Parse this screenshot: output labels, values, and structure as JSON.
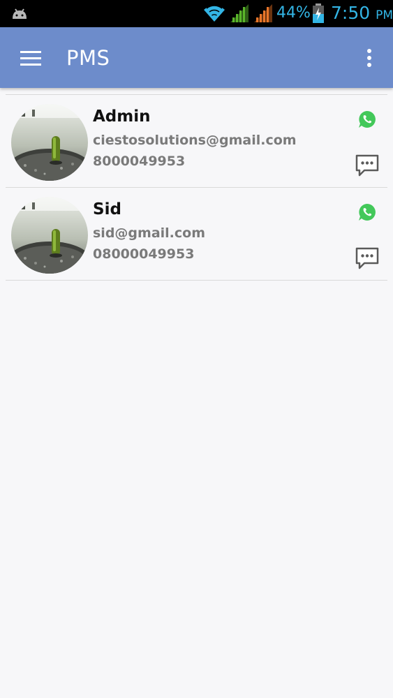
{
  "status_bar": {
    "battery_percent": "44%",
    "time": "7:50",
    "ampm": "PM",
    "icons": [
      "android-icon",
      "wifi-icon",
      "signal-icon",
      "signal-icon",
      "battery-charging-icon"
    ],
    "colors": {
      "text": "#33b5e5",
      "signal1": "#5ab52a",
      "signal2": "#e8762a"
    }
  },
  "app_bar": {
    "title": "PMS",
    "color": "#6d8ccb",
    "menu_icon": "hamburger-menu-icon",
    "overflow_icon": "more-vert-icon"
  },
  "contacts": [
    {
      "name": "Admin",
      "email": "ciestosolutions@gmail.com",
      "phone": "8000049953",
      "avatar": "sprout-photo",
      "actions": [
        "whatsapp-icon",
        "chat-message-icon"
      ]
    },
    {
      "name": "Sid",
      "email": "sid@gmail.com",
      "phone": "08000049953",
      "avatar": "sprout-photo",
      "actions": [
        "whatsapp-icon",
        "chat-message-icon"
      ]
    }
  ]
}
